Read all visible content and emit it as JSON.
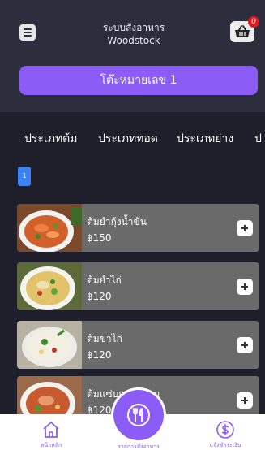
{
  "header": {
    "title_line1": "ระบบสั่งอาหาร",
    "title_line2": "Woodstock",
    "cart_count": "0",
    "table_label": "โต๊ะหมายเลข 1"
  },
  "categories": [
    "ประเภทต้ม",
    "ประเภททอด",
    "ประเภทย่าง",
    "ป"
  ],
  "pagination": {
    "current": "1"
  },
  "menu_items": [
    {
      "name": "ต้มยำกุ้งน้ำข้น",
      "price": "฿150"
    },
    {
      "name": "ต้มยำไก่",
      "price": "฿120"
    },
    {
      "name": "ต้มข่าไก่",
      "price": "฿120"
    },
    {
      "name": "ต้มแซ่บกระดูกหมู",
      "price": "฿120"
    }
  ],
  "bottom_nav": {
    "home": "หน้าหลัก",
    "orders": "รายการสั่งอาหาร",
    "payment": "แจ้งชำระเงิน"
  },
  "colors": {
    "background": "#1e1f2a",
    "header": "#2c2e3e",
    "accent": "#8b5cf6",
    "item_bg": "#6a6a6a",
    "badge": "#e11b22",
    "page_button": "#3b82f6"
  }
}
